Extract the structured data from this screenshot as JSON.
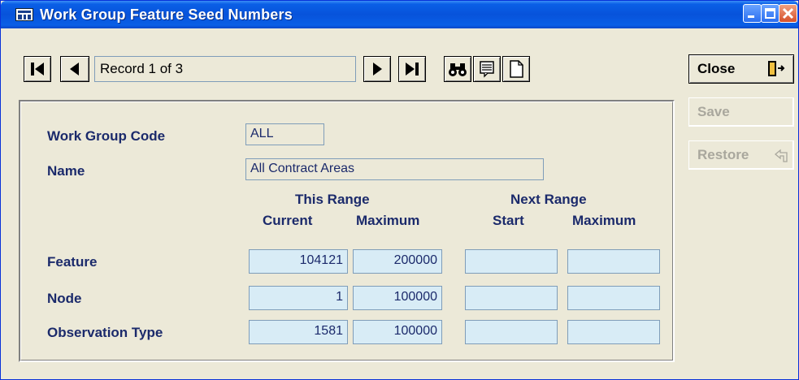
{
  "window": {
    "title": "Work Group Feature Seed Numbers"
  },
  "navigator": {
    "record_text": "Record 1 of 3"
  },
  "side_buttons": {
    "close": "Close",
    "save": "Save",
    "restore": "Restore"
  },
  "form": {
    "work_group_code": {
      "label": "Work Group Code",
      "value": "ALL"
    },
    "name": {
      "label": "Name",
      "value": "All Contract Areas"
    },
    "group_headers": {
      "this_range": "This Range",
      "next_range": "Next Range"
    },
    "columns": {
      "current": "Current",
      "maximum": "Maximum",
      "start": "Start",
      "next_maximum": "Maximum"
    },
    "rows": [
      {
        "label": "Feature",
        "current": "104121",
        "maximum": "200000",
        "start": "",
        "next_maximum": ""
      },
      {
        "label": "Node",
        "current": "1",
        "maximum": "100000",
        "start": "",
        "next_maximum": ""
      },
      {
        "label": "Observation Type",
        "current": "1581",
        "maximum": "100000",
        "start": "",
        "next_maximum": ""
      }
    ]
  },
  "colors": {
    "titlebar": "#0753db",
    "label_text": "#1b2a6b",
    "field_bg": "#d8ecf6",
    "window_bg": "#ece9d8"
  },
  "icons": [
    "app-icon",
    "minimize-icon",
    "maximize-icon",
    "close-window-icon",
    "first-record-icon",
    "previous-record-icon",
    "next-record-icon",
    "last-record-icon",
    "find-binoculars-icon",
    "list-icon",
    "new-record-icon",
    "exit-door-icon",
    "restore-arrow-icon"
  ]
}
